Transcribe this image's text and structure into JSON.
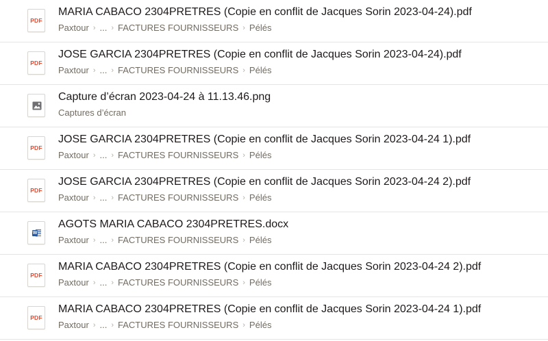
{
  "colors": {
    "pdf_label": "#e8472b",
    "word_blue": "#2b579a",
    "image_gray": "#6e6e73",
    "text_primary": "#1e1919",
    "text_secondary": "#716b61",
    "divider": "#e6e4e1"
  },
  "files": [
    {
      "name": "MARIA CABACO 2304PRETRES (Copie en conflit de Jacques Sorin 2023-04-24).pdf",
      "type": "pdf",
      "icon": "pdf-file-icon",
      "icon_text": "PDF",
      "path": [
        "Paxtour",
        "...",
        "FACTURES FOURNISSEURS",
        "Pélés"
      ]
    },
    {
      "name": "JOSE GARCIA 2304PRETRES (Copie en conflit de Jacques Sorin 2023-04-24).pdf",
      "type": "pdf",
      "icon": "pdf-file-icon",
      "icon_text": "PDF",
      "path": [
        "Paxtour",
        "...",
        "FACTURES FOURNISSEURS",
        "Pélés"
      ]
    },
    {
      "name": "Capture d’écran 2023-04-24 à 11.13.46.png",
      "type": "image",
      "icon": "image-file-icon",
      "icon_text": "",
      "path": [
        "Captures d’écran"
      ]
    },
    {
      "name": "JOSE GARCIA 2304PRETRES (Copie en conflit de Jacques Sorin 2023-04-24 1).pdf",
      "type": "pdf",
      "icon": "pdf-file-icon",
      "icon_text": "PDF",
      "path": [
        "Paxtour",
        "...",
        "FACTURES FOURNISSEURS",
        "Pélés"
      ]
    },
    {
      "name": "JOSE GARCIA 2304PRETRES (Copie en conflit de Jacques Sorin 2023-04-24 2).pdf",
      "type": "pdf",
      "icon": "pdf-file-icon",
      "icon_text": "PDF",
      "path": [
        "Paxtour",
        "...",
        "FACTURES FOURNISSEURS",
        "Pélés"
      ]
    },
    {
      "name": "AGOTS MARIA CABACO 2304PRETRES.docx",
      "type": "docx",
      "icon": "word-file-icon",
      "icon_text": "W",
      "path": [
        "Paxtour",
        "...",
        "FACTURES FOURNISSEURS",
        "Pélés"
      ]
    },
    {
      "name": "MARIA CABACO 2304PRETRES (Copie en conflit de Jacques Sorin 2023-04-24 2).pdf",
      "type": "pdf",
      "icon": "pdf-file-icon",
      "icon_text": "PDF",
      "path": [
        "Paxtour",
        "...",
        "FACTURES FOURNISSEURS",
        "Pélés"
      ]
    },
    {
      "name": "MARIA CABACO 2304PRETRES (Copie en conflit de Jacques Sorin 2023-04-24 1).pdf",
      "type": "pdf",
      "icon": "pdf-file-icon",
      "icon_text": "PDF",
      "path": [
        "Paxtour",
        "...",
        "FACTURES FOURNISSEURS",
        "Pélés"
      ]
    }
  ]
}
